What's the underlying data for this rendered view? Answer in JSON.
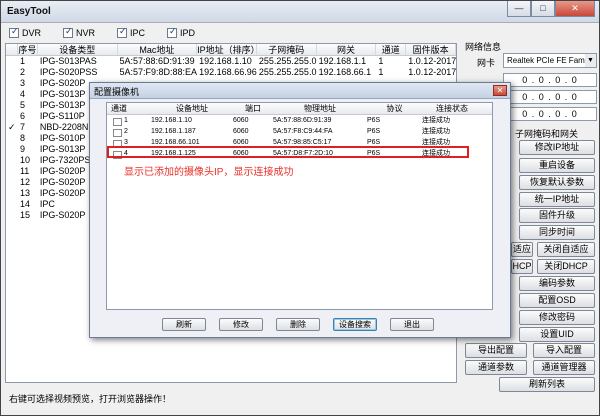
{
  "app": {
    "title": "EasyTool"
  },
  "window_buttons": {
    "minimize": "—",
    "maximize": "□",
    "close": "✕"
  },
  "filters": [
    {
      "label": "DVR",
      "checked": true
    },
    {
      "label": "NVR",
      "checked": true
    },
    {
      "label": "IPC",
      "checked": true
    },
    {
      "label": "IPD",
      "checked": true
    }
  ],
  "device_table": {
    "headers": [
      "",
      "序号",
      "设备类型",
      "Mac地址",
      "IP地址（排序）",
      "子网掩码",
      "网关",
      "通道",
      "固件版本"
    ],
    "rows": [
      {
        "check": "",
        "no": "1",
        "type": "IPG-S013PAS",
        "mac": "5A:57:88:6D:91:39",
        "ip": "192.168.1.10",
        "mask": "255.255.255.0",
        "gw": "192.168.1.1",
        "ch": "1",
        "fw": "1.0.12-2017"
      },
      {
        "check": "",
        "no": "2",
        "type": "IPG-S020PSS",
        "mac": "5A:57:F9:8D:88:EA",
        "ip": "192.168.66.96",
        "mask": "255.255.255.0",
        "gw": "192.168.66.1",
        "ch": "1",
        "fw": "1.0.12-2017"
      },
      {
        "check": "",
        "no": "3",
        "type": "IPG-S020P",
        "mac": "",
        "ip": "",
        "mask": "",
        "gw": "",
        "ch": "",
        "fw": ""
      },
      {
        "check": "",
        "no": "4",
        "type": "IPG-S013P",
        "mac": "",
        "ip": "",
        "mask": "",
        "gw": "",
        "ch": "",
        "fw": ""
      },
      {
        "check": "",
        "no": "5",
        "type": "IPG-S013P",
        "mac": "",
        "ip": "",
        "mask": "",
        "gw": "",
        "ch": "",
        "fw": ""
      },
      {
        "check": "",
        "no": "6",
        "type": "IPG-S110P",
        "mac": "",
        "ip": "",
        "mask": "",
        "gw": "",
        "ch": "",
        "fw": ""
      },
      {
        "check": "✓",
        "no": "7",
        "type": "NBD-2208NR",
        "mac": "",
        "ip": "",
        "mask": "",
        "gw": "",
        "ch": "",
        "fw": ""
      },
      {
        "check": "",
        "no": "8",
        "type": "IPG-S010P",
        "mac": "",
        "ip": "",
        "mask": "",
        "gw": "",
        "ch": "",
        "fw": ""
      },
      {
        "check": "",
        "no": "9",
        "type": "IPG-S013P",
        "mac": "",
        "ip": "",
        "mask": "",
        "gw": "",
        "ch": "",
        "fw": ""
      },
      {
        "check": "",
        "no": "10",
        "type": "IPG-7320PS",
        "mac": "",
        "ip": "",
        "mask": "",
        "gw": "",
        "ch": "",
        "fw": ""
      },
      {
        "check": "",
        "no": "11",
        "type": "IPG-S020P",
        "mac": "",
        "ip": "",
        "mask": "",
        "gw": "",
        "ch": "",
        "fw": ""
      },
      {
        "check": "",
        "no": "12",
        "type": "IPG-S020P",
        "mac": "",
        "ip": "",
        "mask": "",
        "gw": "",
        "ch": "",
        "fw": ""
      },
      {
        "check": "",
        "no": "13",
        "type": "IPG-S020P",
        "mac": "",
        "ip": "",
        "mask": "",
        "gw": "",
        "ch": "",
        "fw": ""
      },
      {
        "check": "",
        "no": "14",
        "type": "IPC",
        "mac": "",
        "ip": "",
        "mask": "",
        "gw": "",
        "ch": "",
        "fw": ""
      },
      {
        "check": "",
        "no": "15",
        "type": "IPG-S020P",
        "mac": "",
        "ip": "",
        "mask": "",
        "gw": "",
        "ch": "",
        "fw": ""
      }
    ]
  },
  "status": {
    "text": "右键可选择视频预览，打开浏览器操作！"
  },
  "right_panel": {
    "group_label": "网络信息",
    "nic_label": "网卡",
    "nic_value": "Realtek PCIe FE Family",
    "ip_fields": [
      "0 . 0 . 0 . 0",
      "0 . 0 . 0 . 0",
      "0 . 0 . 0 . 0"
    ],
    "section_label": "子网掩码和网关",
    "buttons": {
      "modify_ip": "修改IP地址",
      "restart": "重启设备",
      "restore": "恢复默认参数",
      "unify_ip": "统一IP地址",
      "firmware": "固件升级",
      "sync_time": "同步时间",
      "adaptive_suffix": "适应",
      "close_adaptive": "关闭自适应",
      "dhcp_suffix": "HCP",
      "close_dhcp": "关闭DHCP",
      "encode": "编码参数",
      "osd": "配置OSD",
      "change_pwd": "修改密码",
      "set_uid": "设置UID",
      "export": "导出配置",
      "import": "导入配置",
      "channel_params": "通道参数",
      "channel_manager": "通道管理器",
      "refresh_list": "刷新列表"
    }
  },
  "dialog": {
    "title": "配置摄像机",
    "close": "✕",
    "headers": [
      "通道",
      "设备地址",
      "端口",
      "物理地址",
      "协议",
      "连接状态"
    ],
    "rows": [
      {
        "ch": "1",
        "addr": "192.168.1.10",
        "port": "6060",
        "mac": "5A:57:88:6D:91:39",
        "proto": "P6S",
        "state": "连接成功"
      },
      {
        "ch": "2",
        "addr": "192.168.1.187",
        "port": "6060",
        "mac": "5A:57:F8:C9:44:FA",
        "proto": "P6S",
        "state": "连接成功"
      },
      {
        "ch": "3",
        "addr": "192.168.66.101",
        "port": "6060",
        "mac": "5A:57:98:85:C5:17",
        "proto": "P6S",
        "state": "连接成功"
      },
      {
        "ch": "4",
        "addr": "192.168.1.125",
        "port": "6060",
        "mac": "5A:57:D8:F7:2D:10",
        "proto": "P6S",
        "state": "连接成功"
      }
    ],
    "annotation": "显示已添加的摄像头IP，显示连接成功",
    "annotation_color": "#e8302a",
    "buttons": {
      "refresh": "刷新",
      "modify": "修改",
      "delete": "删除",
      "search": "设备搜索",
      "exit": "退出"
    }
  }
}
